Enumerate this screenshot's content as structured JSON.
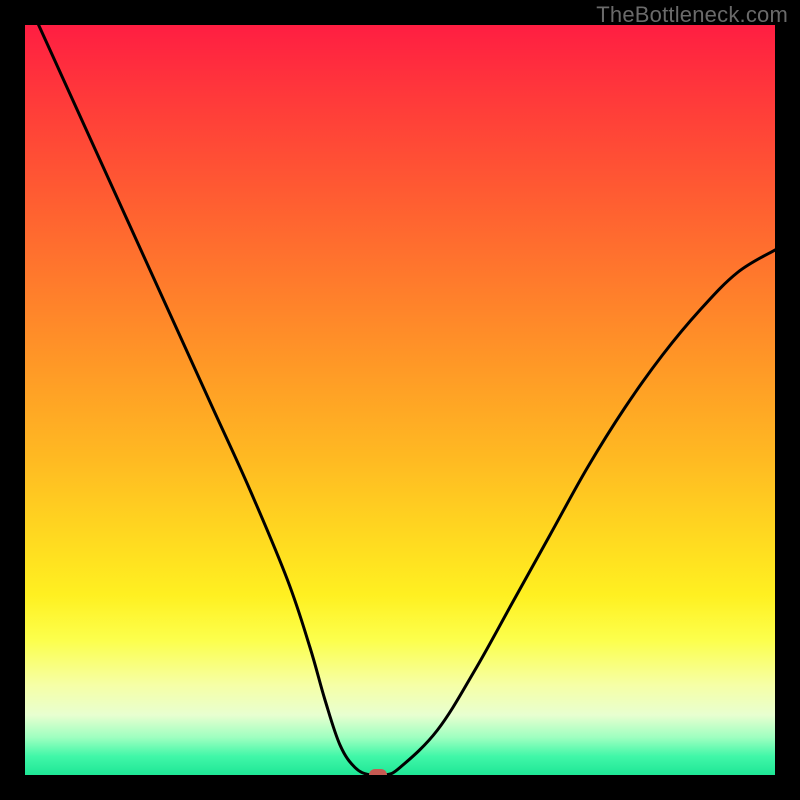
{
  "watermark": "TheBottleneck.com",
  "chart_data": {
    "type": "line",
    "title": "",
    "xlabel": "",
    "ylabel": "",
    "xlim": [
      0,
      100
    ],
    "ylim": [
      0,
      100
    ],
    "grid": false,
    "series": [
      {
        "name": "bottleneck-curve",
        "color": "#000000",
        "x": [
          0,
          5,
          10,
          15,
          20,
          25,
          30,
          35,
          38,
          40,
          42,
          44,
          46,
          48,
          50,
          55,
          60,
          65,
          70,
          75,
          80,
          85,
          90,
          95,
          100
        ],
        "values": [
          104,
          93,
          82,
          71,
          60,
          49,
          38,
          26,
          17,
          10,
          4,
          1,
          0,
          0,
          1,
          6,
          14,
          23,
          32,
          41,
          49,
          56,
          62,
          67,
          70
        ]
      }
    ],
    "marker": {
      "x": 47,
      "y": 0,
      "color": "#c65a52"
    }
  }
}
